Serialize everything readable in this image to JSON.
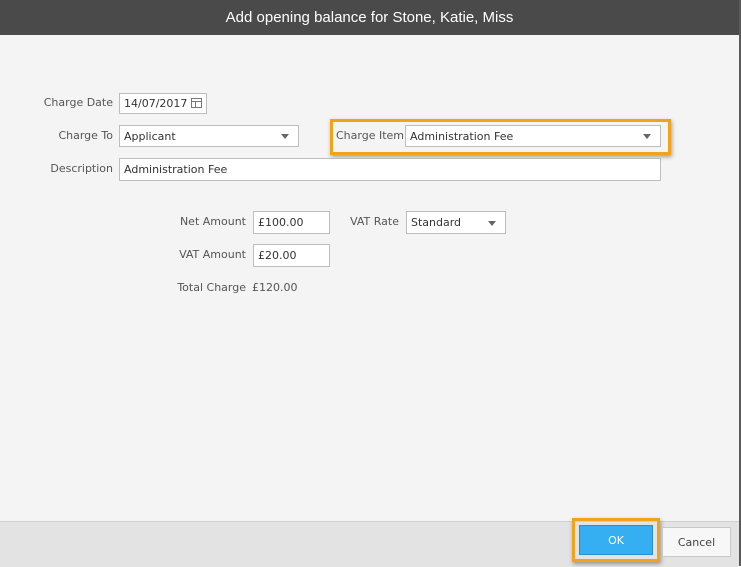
{
  "dialog": {
    "title": "Add opening balance for Stone, Katie, Miss"
  },
  "form": {
    "charge_date": {
      "label": "Charge Date",
      "value": "14/07/2017"
    },
    "charge_to": {
      "label": "Charge To",
      "value": "Applicant"
    },
    "charge_item": {
      "label": "Charge Item",
      "value": "Administration Fee"
    },
    "description": {
      "label": "Description",
      "value": "Administration Fee"
    },
    "net_amount": {
      "label": "Net Amount",
      "value": "£100.00"
    },
    "vat_rate": {
      "label": "VAT Rate",
      "value": "Standard"
    },
    "vat_amount": {
      "label": "VAT Amount",
      "value": "£20.00"
    },
    "total_charge": {
      "label": "Total Charge",
      "value": "£120.00"
    }
  },
  "footer": {
    "ok_label": "OK",
    "cancel_label": "Cancel"
  },
  "colors": {
    "titlebar": "#4a4a4a",
    "highlight": "#f2a21b",
    "ok_button": "#36aef2"
  },
  "icons": {
    "calendar": "calendar-icon",
    "dropdown": "chevron-down-icon"
  }
}
